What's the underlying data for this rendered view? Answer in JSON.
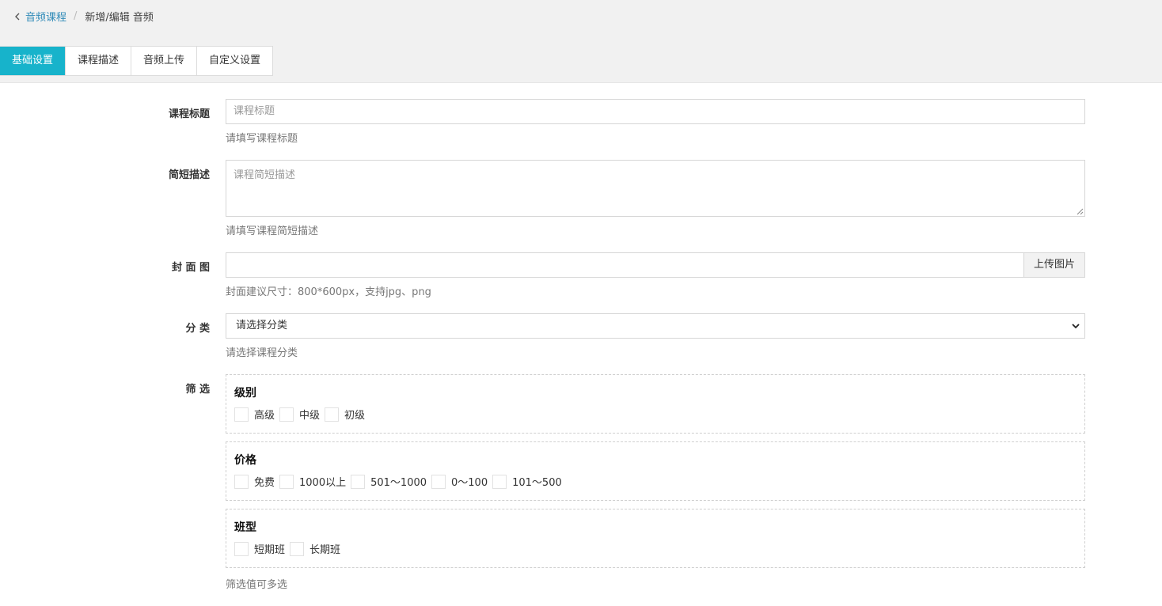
{
  "breadcrumb": {
    "parent": "音频课程",
    "separator": "/",
    "current": "新增/编辑 音频"
  },
  "tabs": [
    {
      "label": "基础设置",
      "active": true
    },
    {
      "label": "课程描述",
      "active": false
    },
    {
      "label": "音频上传",
      "active": false
    },
    {
      "label": "自定义设置",
      "active": false
    }
  ],
  "form": {
    "title": {
      "label": "课程标题",
      "placeholder": "课程标题",
      "help": "请填写课程标题"
    },
    "summary": {
      "label": "简短描述",
      "placeholder": "课程简短描述",
      "help": "请填写课程简短描述"
    },
    "cover": {
      "label": "封 面 图",
      "button": "上传图片",
      "help": "封面建议尺寸：800*600px，支持jpg、png"
    },
    "category": {
      "label": "分 类",
      "selected": "请选择分类",
      "help": "请选择课程分类"
    },
    "filter": {
      "label": "筛 选",
      "help": "筛选值可多选",
      "groups": [
        {
          "title": "级别",
          "options": [
            "高级",
            "中级",
            "初级"
          ]
        },
        {
          "title": "价格",
          "options": [
            "免费",
            "1000以上",
            "501～1000",
            "0～100",
            "101～500"
          ]
        },
        {
          "title": "班型",
          "options": [
            "短期班",
            "长期班"
          ]
        }
      ]
    }
  },
  "colors": {
    "accent": "#17b3cb",
    "link": "#2f8ab8",
    "topbar_bg": "#f1f1f1"
  },
  "icons": {
    "back": "chevron-left-icon",
    "select": "chevron-down-icon",
    "resize": "resize-grip-icon"
  }
}
